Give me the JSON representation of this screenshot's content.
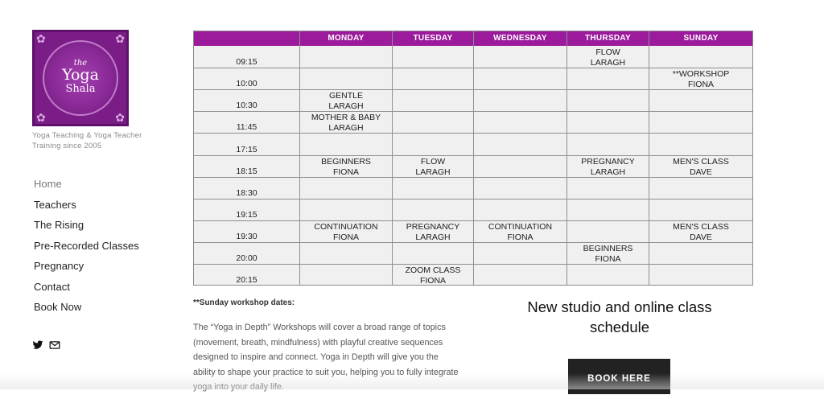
{
  "brand": {
    "logo_line1": "the",
    "logo_line2": "Yoga",
    "logo_line3": "Shala",
    "tagline": "Yoga Teaching & Yoga Teacher Training since 2005",
    "color_primary": "#7a1d86"
  },
  "nav": {
    "items": [
      {
        "label": "Home"
      },
      {
        "label": "Teachers"
      },
      {
        "label": "The Rising"
      },
      {
        "label": "Pre-Recorded Classes"
      },
      {
        "label": "Pregnancy"
      },
      {
        "label": "Contact"
      },
      {
        "label": "Book Now"
      }
    ]
  },
  "social": {
    "icons": [
      "twitter-icon",
      "email-icon"
    ]
  },
  "timetable": {
    "header_color": "#9c1a9c",
    "days": [
      "MONDAY",
      "TUESDAY",
      "WEDNESDAY",
      "THURSDAY",
      "SUNDAY"
    ],
    "times": [
      "09:15",
      "10:00",
      "10:30",
      "11:45",
      "17:15",
      "18:15",
      "18:30",
      "19:15",
      "19:30",
      "20:00",
      "20:15"
    ],
    "cells": {
      "r0_thu_1": "FLOW",
      "r0_thu_2": "LARAGH",
      "r1_sun_1": "**WORKSHOP",
      "r1_sun_2": "FIONA",
      "r2_mon_1": "GENTLE",
      "r2_mon_2": "LARAGH",
      "r3_mon_1": "MOTHER & BABY",
      "r3_mon_2": "LARAGH",
      "r5_mon_1": "BEGINNERS",
      "r5_mon_2": "FIONA",
      "r5_tue_1": "FLOW",
      "r5_tue_2": "LARAGH",
      "r5_thu_1": "PREGNANCY",
      "r5_thu_2": "LARAGH",
      "r5_sun_1": "MEN'S CLASS",
      "r5_sun_2": "DAVE",
      "r8_mon_1": "CONTINUATION",
      "r8_mon_2": "FIONA",
      "r8_tue_1": "PREGNANCY",
      "r8_tue_2": "LARAGH",
      "r8_wed_1": "CONTINUATION",
      "r8_wed_2": "FIONA",
      "r8_sun_1": "MEN'S CLASS",
      "r8_sun_2": "DAVE",
      "r9_thu_1": "BEGINNERS",
      "r9_thu_2": "FIONA",
      "r10_tue_1": "ZOOM CLASS",
      "r10_tue_2": "FIONA"
    }
  },
  "workshop": {
    "title": "**Sunday workshop dates:",
    "body": "The “Yoga in Depth” Workshops will cover a broad range of topics (movement, breath, mindfulness) with playful creative sequences designed to inspire and connect. Yoga in Depth will give you the ability to shape your practice to suit you, helping you to fully integrate yoga into your daily life."
  },
  "studio": {
    "title": "New studio and online class schedule",
    "button_label": "BOOK HERE"
  }
}
